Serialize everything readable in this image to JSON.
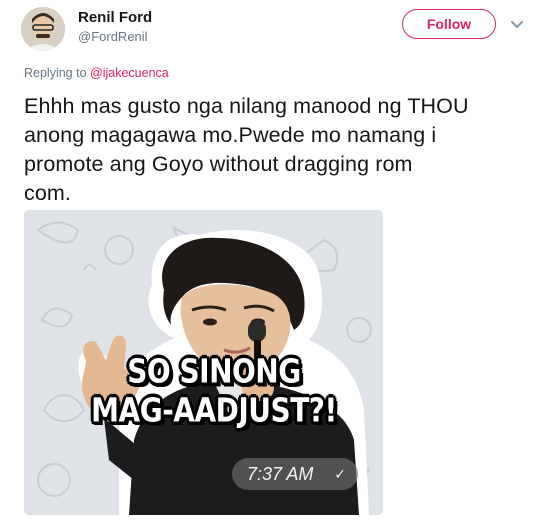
{
  "user": {
    "display_name": "Renil Ford",
    "handle": "@FordRenil",
    "avatar_icon": "user-avatar"
  },
  "header": {
    "follow_label": "Follow",
    "menu_icon": "chevron-down-icon"
  },
  "reply": {
    "prefix": "Replying to ",
    "mention": "@ijakecuenca"
  },
  "tweet": {
    "text": "Ehhh mas gusto nga nilang manood ng THOU\nanong magagawa mo.Pwede mo namang i\npromote ang Goyo without dragging rom\ncom."
  },
  "media": {
    "caption_line1": "SO SINONG",
    "caption_line2": "MAG-AADJUST?!",
    "chat_time": "7:37 AM",
    "check_icon": "check-icon"
  },
  "colors": {
    "accent": "#e0245e",
    "secondary_text": "#657786",
    "primary_text": "#14171a"
  }
}
